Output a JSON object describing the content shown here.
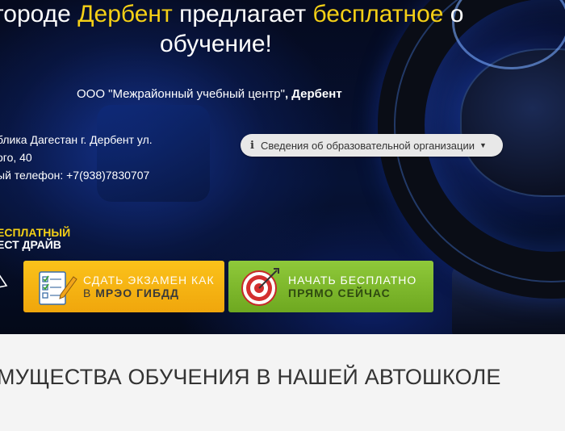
{
  "hero": {
    "title_line1_prefix": "городе ",
    "title_line1_city": "Дербент",
    "title_line1_mid": " предлагает ",
    "title_line1_free": "бесплатное",
    "title_line1_tail": " о",
    "title_line2": "обучение!",
    "org_name": "ООО \"Межрайонный учебный центр\"",
    "org_city": ", Дербент",
    "address_line1": "блика Дагестан г. Дербент ул.",
    "address_line2": "ого, 40",
    "phone_line": "ый телефон: +7(938)7830707",
    "info_button_label": "Сведения об образовательной организации",
    "testdrive_line1": "ЕСПЛАТНЫЙ",
    "testdrive_line2": "ЕСТ ДРАЙВ",
    "colors": {
      "accent_yellow": "#f5d016",
      "cta_yellow": "#f7b515",
      "cta_green": "#82bd2e"
    }
  },
  "cta": {
    "exam_line1": "СДАТЬ ЭКЗАМЕН КАК",
    "exam_line2_prefix": "В ",
    "exam_line2_bold": "МРЭО ГИБДД",
    "exam_icon": "checklist-icon",
    "start_line1": "НАЧАТЬ БЕСПЛАТНО",
    "start_line2": "ПРЯМО СЕЙЧАС",
    "start_icon": "target-icon"
  },
  "section": {
    "title": "МУЩЕСТВА ОБУЧЕНИЯ В НАШЕЙ АВТОШКОЛЕ"
  }
}
